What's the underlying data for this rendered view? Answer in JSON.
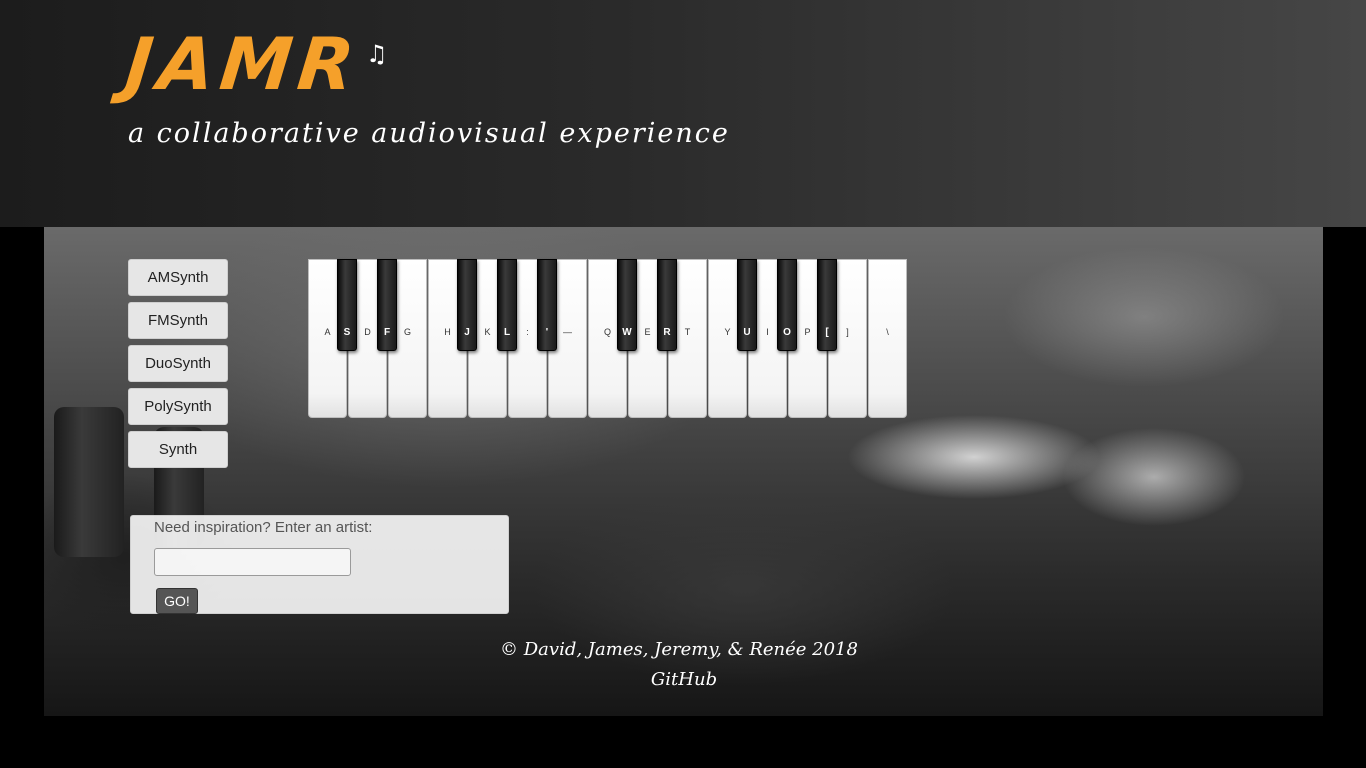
{
  "header": {
    "logo": "JAMR",
    "logo_note": "♫",
    "tagline": "a collaborative audiovisual experience"
  },
  "synths": [
    "AMSynth",
    "FMSynth",
    "DuoSynth",
    "PolySynth",
    "Synth"
  ],
  "piano": {
    "white_keys": [
      "A",
      "D",
      "G",
      "H",
      "K",
      ":",
      "—",
      "Q",
      "E",
      "T",
      "Y",
      "I",
      "P",
      "]",
      "\\"
    ],
    "black_keys": [
      "S",
      "F",
      "J",
      "L",
      "'",
      "W",
      "R",
      "U",
      "O",
      "["
    ]
  },
  "inspiration": {
    "label": "Need inspiration? Enter an artist:",
    "input_value": "",
    "go_label": "GO!"
  },
  "footer": {
    "credits": "© David, James, Jeremy, & Renée 2018",
    "github": "GitHub"
  }
}
